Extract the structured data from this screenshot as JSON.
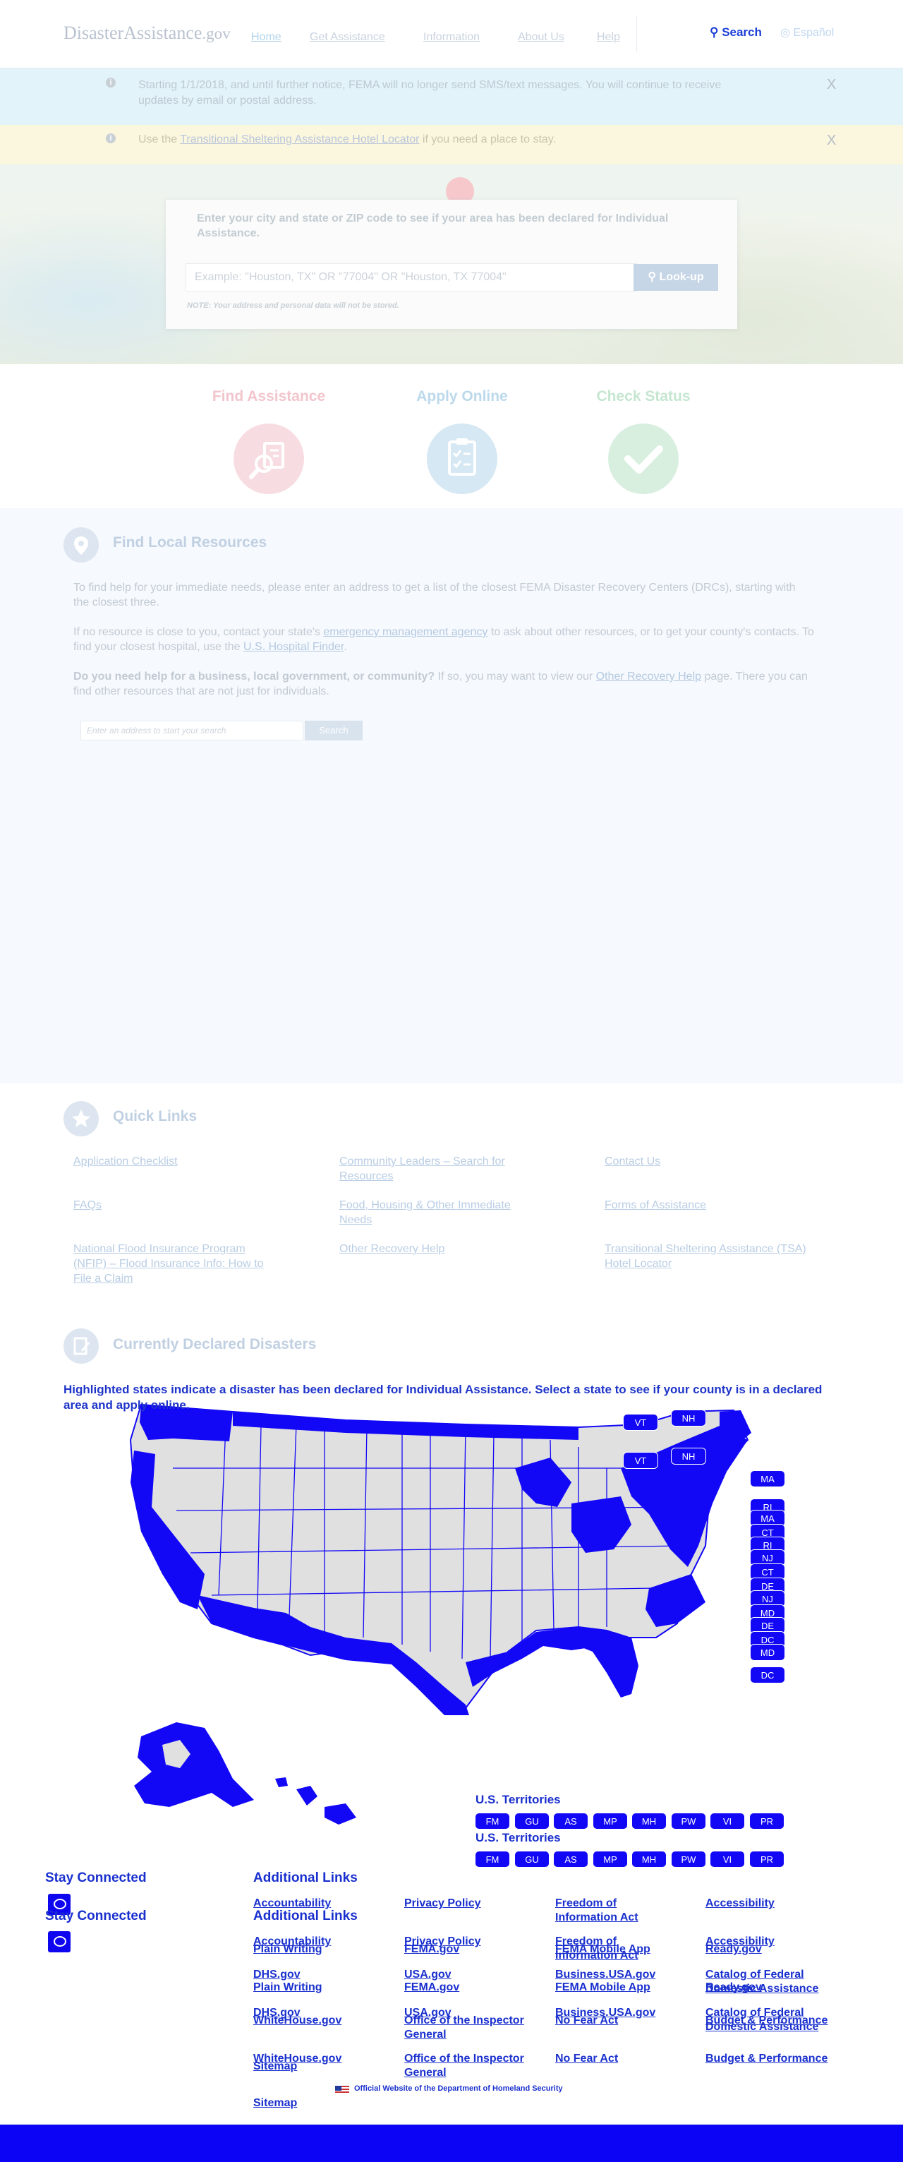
{
  "header": {
    "logo_main": "DisasterAssistance",
    "logo_suffix": ".gov",
    "nav": [
      "Home",
      "Get Assistance",
      "Information",
      "About Us",
      "Help"
    ],
    "search_label": "Search",
    "language_label": "Español"
  },
  "alerts": [
    {
      "text": "Starting 1/1/2018, and until further notice, FEMA will no longer send SMS/text messages. You will continue to receive updates by email or postal address.",
      "close": "X"
    },
    {
      "prefix": "Use the ",
      "link": "Transitional Sheltering Assistance Hotel Locator",
      "suffix": " if you need a place to stay.",
      "close": "X"
    }
  ],
  "hero": {
    "prompt": "Enter your city and state or ZIP code to see if your area has been declared for Individual Assistance.",
    "placeholder": "Example: \"Houston, TX\" OR \"77004\" OR \"Houston, TX 77004\"",
    "button": "Look-up",
    "note": "NOTE: Your address and personal data will not be stored."
  },
  "actions": [
    {
      "label": "Find Assistance",
      "color": "#f2c5cc",
      "circle": "#f7dde2"
    },
    {
      "label": "Apply Online",
      "color": "#bcd9ec",
      "circle": "#d6e8f3"
    },
    {
      "label": "Check Status",
      "color": "#c5e6d0",
      "circle": "#d8efe0"
    }
  ],
  "local": {
    "title": "Find Local Resources",
    "p1": "To find help for your immediate needs, please enter an address to get a list of the closest FEMA Disaster Recovery Centers (DRCs), starting with the closest three.",
    "p2_a": "If no resource is close to you, contact your state's ",
    "p2_link1": "emergency management agency",
    "p2_b": " to ask about other resources, or to get your county's contacts. To find your closest hospital, use the ",
    "p2_link2": "U.S. Hospital Finder",
    "p2_c": ".",
    "p3_bold": "Do you need help for a business, local government, or community?",
    "p3_a": " If so, you may want to view our ",
    "p3_link": "Other Recovery Help",
    "p3_b": " page. There you can find other resources that are not just for individuals.",
    "search_placeholder": "Enter an address to start your search",
    "search_button": "Search"
  },
  "quick_links": {
    "title": "Quick Links",
    "items": [
      "Application Checklist",
      "Community Leaders – Search for Resources",
      "Contact Us",
      "FAQs",
      "Food, Housing & Other Immediate Needs",
      "Forms of Assistance",
      "National Flood Insurance Program (NFIP) – Flood Insurance Info: How to File a Claim",
      "Other Recovery Help",
      "Transitional Sheltering Assistance (TSA) Hotel Locator"
    ]
  },
  "declared": {
    "title": "Currently Declared Disasters",
    "intro": "Highlighted states indicate a disaster has been declared for Individual Assistance. Select a state to see if your county is in a declared area and apply online.",
    "top_chips": [
      "VT",
      "NH"
    ],
    "side_chips": [
      "MA",
      "RI",
      "MA",
      "CT",
      "RI",
      "NJ",
      "CT",
      "DE",
      "NJ",
      "MD",
      "DE",
      "DC",
      "MD",
      "DC"
    ],
    "territories_label": "U.S. Territories",
    "territories": [
      "FM",
      "GU",
      "AS",
      "MP",
      "MH",
      "PW",
      "VI",
      "PR"
    ],
    "highlight_color": "#1208f6",
    "state_color": "#e0e0e0"
  },
  "footer": {
    "stay_connected": "Stay Connected",
    "additional_links": "Additional Links",
    "col1": [
      "Accountability",
      "Plain Writing",
      "DHS.gov",
      "WhiteHouse.gov",
      "Sitemap"
    ],
    "col2": [
      "Privacy Policy",
      "FEMA.gov",
      "USA.gov",
      "Office of the Inspector General"
    ],
    "col3": [
      "Freedom of Information Act",
      "FEMA Mobile App",
      "Business.USA.gov",
      "No Fear Act"
    ],
    "col4": [
      "Accessibility",
      "Ready.gov",
      "Catalog of Federal Domestic Assistance",
      "Budget & Performance"
    ],
    "official": "Official Website of the Department of Homeland Security"
  }
}
